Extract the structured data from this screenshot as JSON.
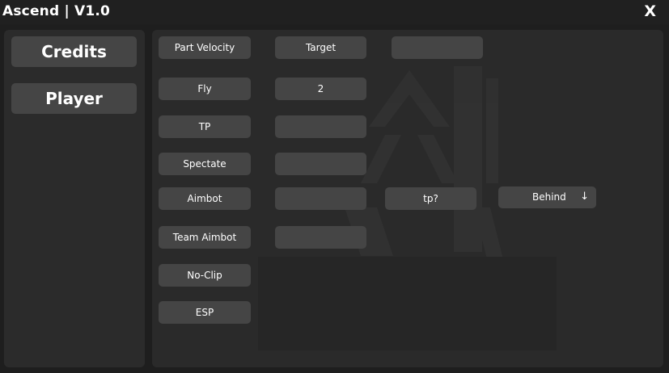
{
  "window": {
    "title": "Ascend | V1.0",
    "close_label": "X"
  },
  "sidebar": {
    "items": [
      {
        "label": "Credits"
      },
      {
        "label": "Player"
      }
    ]
  },
  "player": {
    "buttons": [
      {
        "label": "Part Velocity"
      },
      {
        "label": "Fly"
      },
      {
        "label": "TP"
      },
      {
        "label": "Spectate"
      },
      {
        "label": "Aimbot"
      },
      {
        "label": "Team Aimbot"
      },
      {
        "label": "No-Clip"
      },
      {
        "label": "ESP"
      }
    ],
    "fields": [
      {
        "value": "Target"
      },
      {
        "value": "2"
      },
      {
        "value": ""
      },
      {
        "value": ""
      },
      {
        "value": ""
      },
      {
        "value": ""
      }
    ],
    "extra_field": {
      "value": ""
    },
    "tp_button": {
      "label": "tp?"
    },
    "position_dropdown": {
      "selected": "Behind",
      "arrow_icon": "arrow-down-icon"
    }
  },
  "colors": {
    "background": "#1e1e1e",
    "panel": "#2a2a2a",
    "button": "#454545",
    "text": "#ffffff"
  }
}
